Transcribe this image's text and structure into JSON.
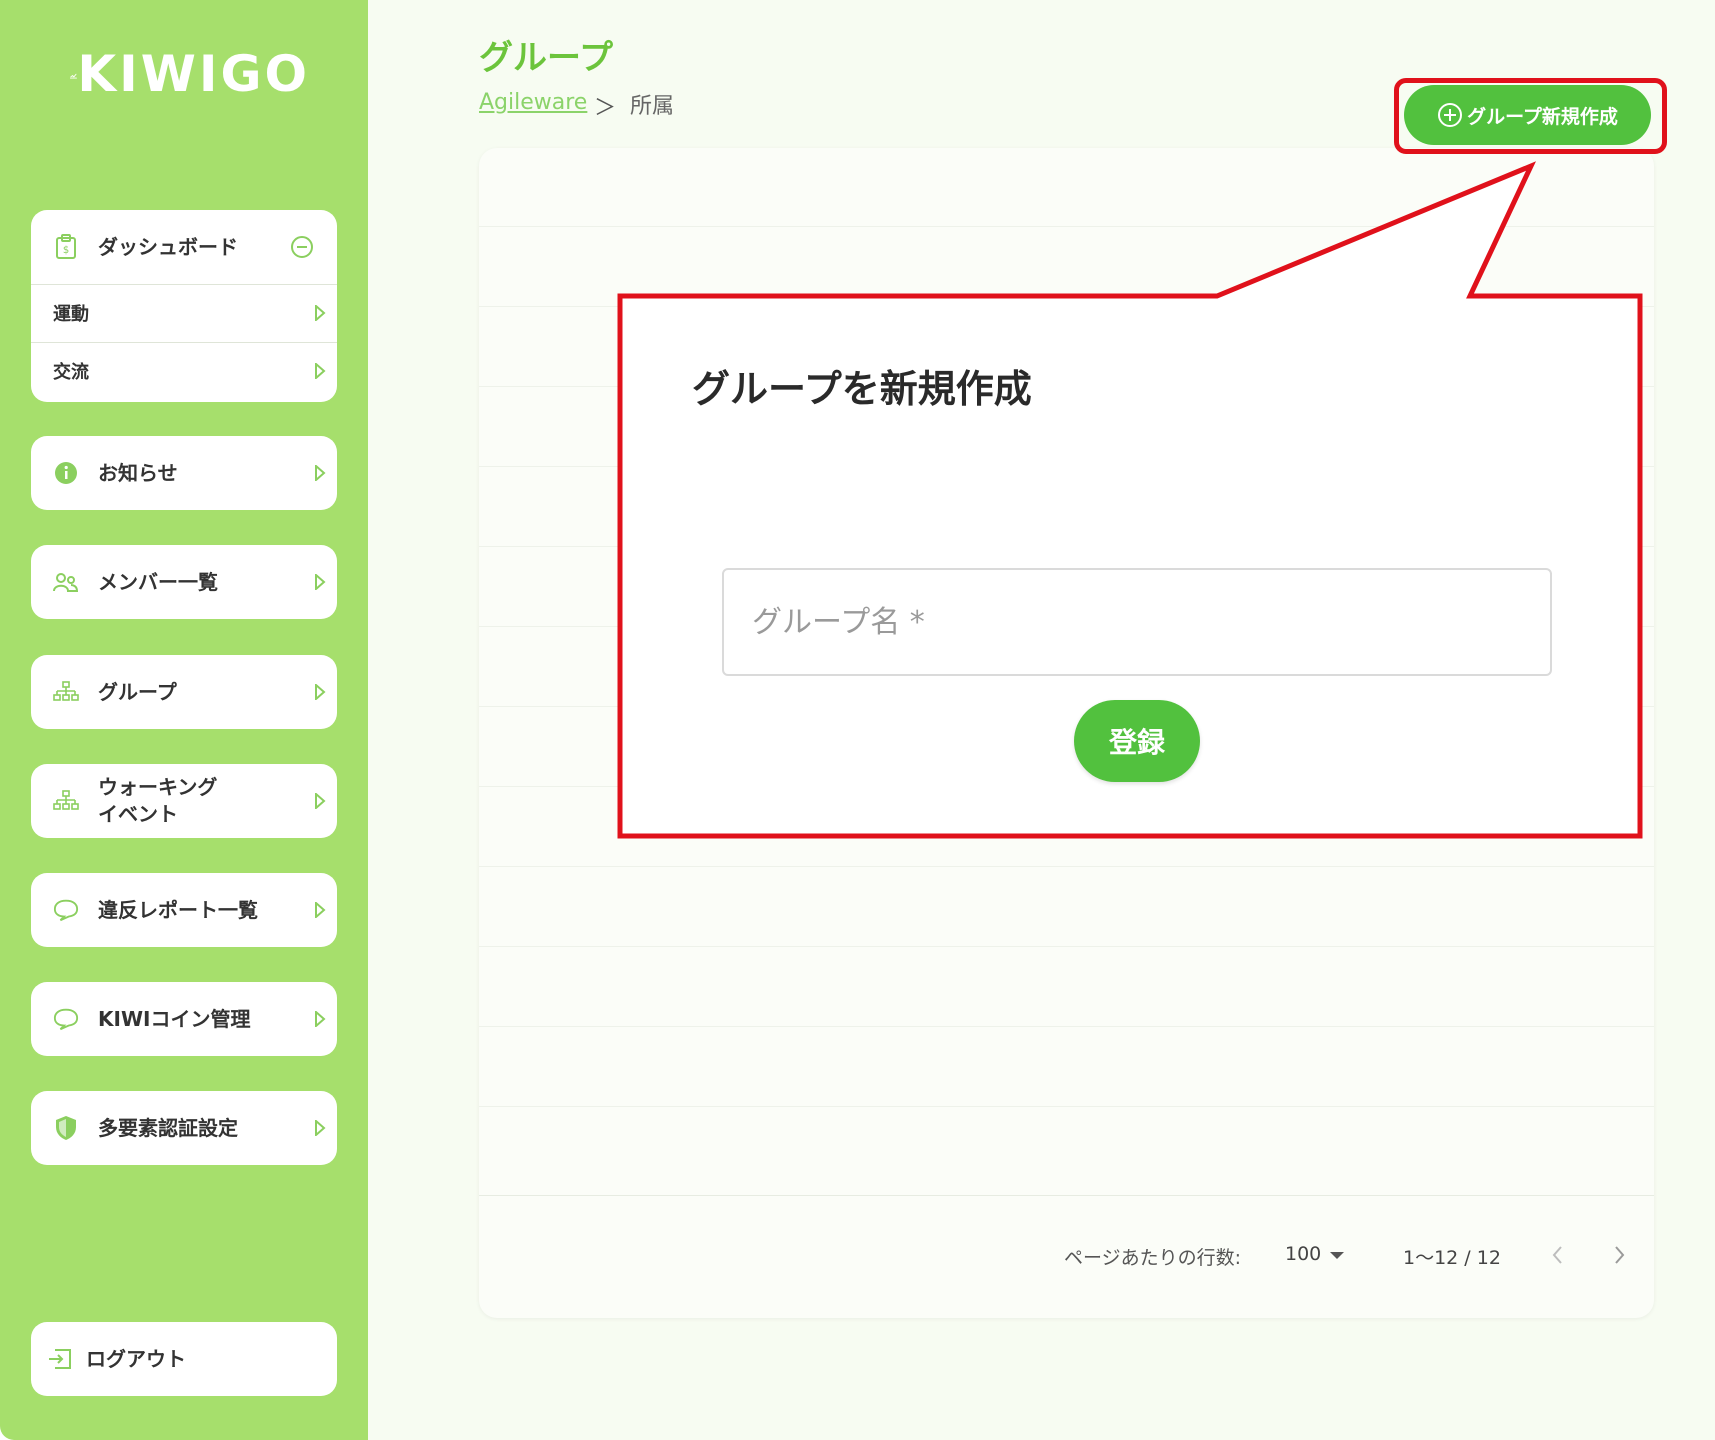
{
  "app": {
    "logo_text": "KIWIGO"
  },
  "sidebar": {
    "dashboard": {
      "label": "ダッシュボード",
      "icon": "clipboard-icon",
      "sub_items": [
        {
          "label": "運動"
        },
        {
          "label": "交流"
        }
      ]
    },
    "items": [
      {
        "label": "お知らせ",
        "icon": "info-icon"
      },
      {
        "label": "メンバー一覧",
        "icon": "users-icon"
      },
      {
        "label": "グループ",
        "icon": "org-chart-icon"
      },
      {
        "label": "ウォーキング\nイベント",
        "line1": "ウォーキング",
        "line2": "イベント",
        "icon": "org-chart-icon"
      },
      {
        "label": "違反レポート一覧",
        "icon": "speech-bubble-icon"
      },
      {
        "label": "KIWIコイン管理",
        "icon": "speech-bubble-icon"
      },
      {
        "label": "多要素認証設定",
        "icon": "shield-icon"
      }
    ],
    "logout": {
      "label": "ログアウト",
      "icon": "logout-icon"
    }
  },
  "header": {
    "title": "グループ",
    "breadcrumb": {
      "link": "Agileware",
      "separator": "＞",
      "current": "所属"
    },
    "create_button": "グループ新規作成"
  },
  "dialog": {
    "title": "グループを新規作成",
    "group_name_placeholder": "グループ名 *",
    "group_name_value": "",
    "submit_label": "登録"
  },
  "pagination": {
    "rows_per_page_label": "ページあたりの行数:",
    "rows_per_page_value": "100",
    "range": "1〜12 / 12"
  },
  "colors": {
    "brand_green": "#52c13e",
    "sidebar_green": "#a6df6c",
    "highlight_red": "#e0111b"
  }
}
